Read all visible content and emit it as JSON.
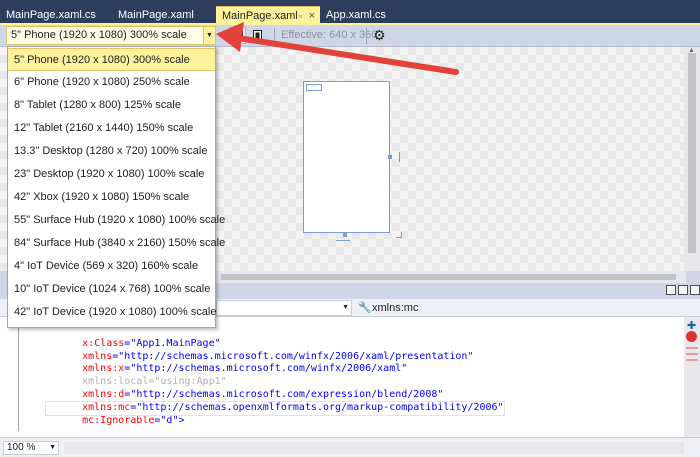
{
  "tabs": [
    {
      "label": "MainPage.xaml.cs"
    },
    {
      "label": "MainPage.xaml"
    },
    {
      "label": "MainPage.xaml",
      "active": true,
      "pin": "▫",
      "close": "×"
    },
    {
      "label": "App.xaml.cs"
    }
  ],
  "toolbar": {
    "device_value": "5\" Phone (1920 x 1080) 300% scale",
    "effective_label": "Effective: 640 x 360"
  },
  "dropdown": {
    "options": [
      "5\" Phone (1920 x 1080) 300% scale",
      "6\" Phone (1920 x 1080) 250% scale",
      "8\" Tablet (1280 x 800) 125% scale",
      "12\" Tablet (2160 x 1440) 150% scale",
      "13.3\" Desktop (1280 x 720) 100% scale",
      "23\" Desktop (1920 x 1080) 100% scale",
      "42\" Xbox (1920 x 1080) 150% scale",
      "55\" Surface Hub (1920 x 1080) 100% scale",
      "84\" Surface Hub (3840 x 2160) 150% scale",
      "4\" IoT Device (569 x 320) 160% scale",
      "10\" IoT Device (1024 x 768) 100% scale",
      "42\" IoT Device (1920 x 1080) 100% scale"
    ]
  },
  "navbar": {
    "right_value": "xmlns:mc"
  },
  "code": {
    "lines": [
      {
        "attr": "x:Class",
        "eq": "=",
        "val": "\"App1.MainPage\""
      },
      {
        "attr": "xmlns",
        "eq": "=",
        "val": "\"http://schemas.microsoft.com/winfx/2006/xaml/presentation\""
      },
      {
        "attr": "xmlns:x",
        "eq": "=",
        "val": "\"http://schemas.microsoft.com/winfx/2006/xaml\""
      },
      {
        "attr": "xmlns:local",
        "eq": "=",
        "val": "\"using:App1\""
      },
      {
        "attr": "xmlns:d",
        "eq": "=",
        "val": "\"http://schemas.microsoft.com/expression/blend/2008\""
      },
      {
        "attr": "xmlns:mc",
        "eq": "=",
        "val": "\"http://schemas.openxmlformats.org/markup-compatibility/2006\""
      },
      {
        "attr": "mc:Ignorable",
        "eq": "=",
        "val": "\"d\">"
      }
    ]
  },
  "status": {
    "zoom": "100 %"
  },
  "colors": {
    "accent": "#fff29d",
    "arrow": "#e2423a"
  }
}
